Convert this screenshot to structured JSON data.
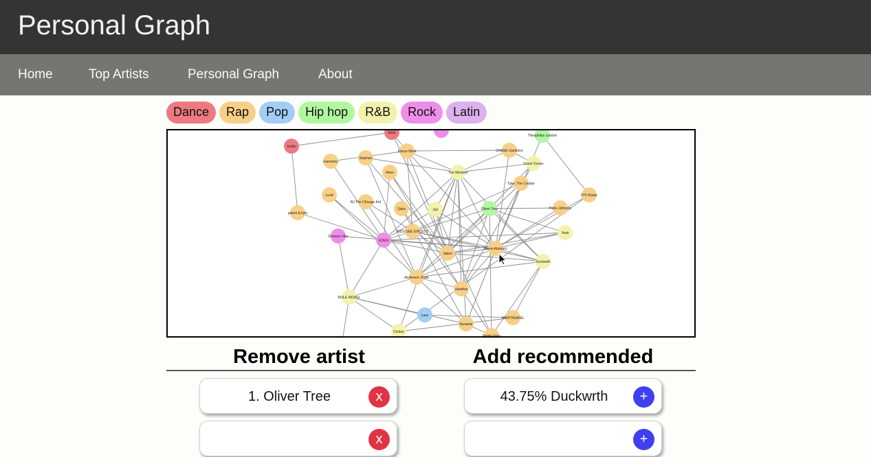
{
  "header": {
    "title": "Personal Graph"
  },
  "nav": {
    "items": [
      "Home",
      "Top Artists",
      "Personal Graph",
      "About"
    ]
  },
  "genres": [
    {
      "label": "Dance",
      "color": "#ec7a80"
    },
    {
      "label": "Rap",
      "color": "#f7cf86"
    },
    {
      "label": "Pop",
      "color": "#a2cdf5"
    },
    {
      "label": "Hip hop",
      "color": "#b1f7a0"
    },
    {
      "label": "R&B",
      "color": "#f3f2ad"
    },
    {
      "label": "Rock",
      "color": "#ef8ee8"
    },
    {
      "label": "Latin",
      "color": "#dcb1ee"
    }
  ],
  "graph": {
    "nodes": [
      {
        "name": "Wale",
        "genre": "Dance"
      },
      {
        "name": "SoMo",
        "genre": "Dance"
      },
      {
        "name": "Theophilus London",
        "genre": "Hip hop"
      },
      {
        "name": "Kanye West",
        "genre": "Rap"
      },
      {
        "name": "Childish Gambino",
        "genre": "Rap"
      },
      {
        "name": "mansionz",
        "genre": "Rap"
      },
      {
        "name": "Stephen",
        "genre": "Rap"
      },
      {
        "name": "Frank Ocean",
        "genre": "R&B"
      },
      {
        "name": "The Weeknd",
        "genre": "R&B"
      },
      {
        "name": "Aries",
        "genre": "Rap"
      },
      {
        "name": "Tyler, The Creator",
        "genre": "Rap"
      },
      {
        "name": "Lund",
        "genre": "Rap"
      },
      {
        "name": "070 Shake",
        "genre": "Rap"
      },
      {
        "name": "BJ The Chicago Kid",
        "genre": "Rap"
      },
      {
        "name": "Saba",
        "genre": "Rap"
      },
      {
        "name": "Joji",
        "genre": "R&B"
      },
      {
        "name": "Oliver Tree",
        "genre": "Hip hop"
      },
      {
        "name": "Hobo Johnson",
        "genre": "Rap"
      },
      {
        "name": "gianni & kyle",
        "genre": "Rap"
      },
      {
        "name": "KIDS SEE GHOSTS",
        "genre": "Rap"
      },
      {
        "name": "Yeek",
        "genre": "R&B"
      },
      {
        "name": "Dominic Fike",
        "genre": "Rock"
      },
      {
        "name": "EDEN",
        "genre": "Rock"
      },
      {
        "name": "Kevin Abstract",
        "genre": "Rap"
      },
      {
        "name": "Jaden",
        "genre": "Rap"
      },
      {
        "name": "Duckwrth",
        "genre": "R&B"
      },
      {
        "name": "Anderson .Paak",
        "genre": "Rap"
      },
      {
        "name": "slowthai",
        "genre": "Rap"
      },
      {
        "name": "ROLE MODEL",
        "genre": "R&B"
      },
      {
        "name": "Lauv",
        "genre": "Pop"
      },
      {
        "name": "EARTHGANG",
        "genre": "Rap"
      },
      {
        "name": "Noname",
        "genre": "Rap"
      },
      {
        "name": "Choker",
        "genre": "R&B"
      },
      {
        "name": "Rome Sosa",
        "genre": "Rap"
      }
    ]
  },
  "remove_section": {
    "heading": "Remove artist",
    "items": [
      {
        "text": "1. Oliver Tree",
        "button": "x"
      },
      {
        "text": "",
        "button": "x"
      }
    ]
  },
  "add_section": {
    "heading": "Add recommended",
    "items": [
      {
        "text": "43.75% Duckwrth",
        "button": "+"
      },
      {
        "text": "",
        "button": "+"
      }
    ]
  }
}
